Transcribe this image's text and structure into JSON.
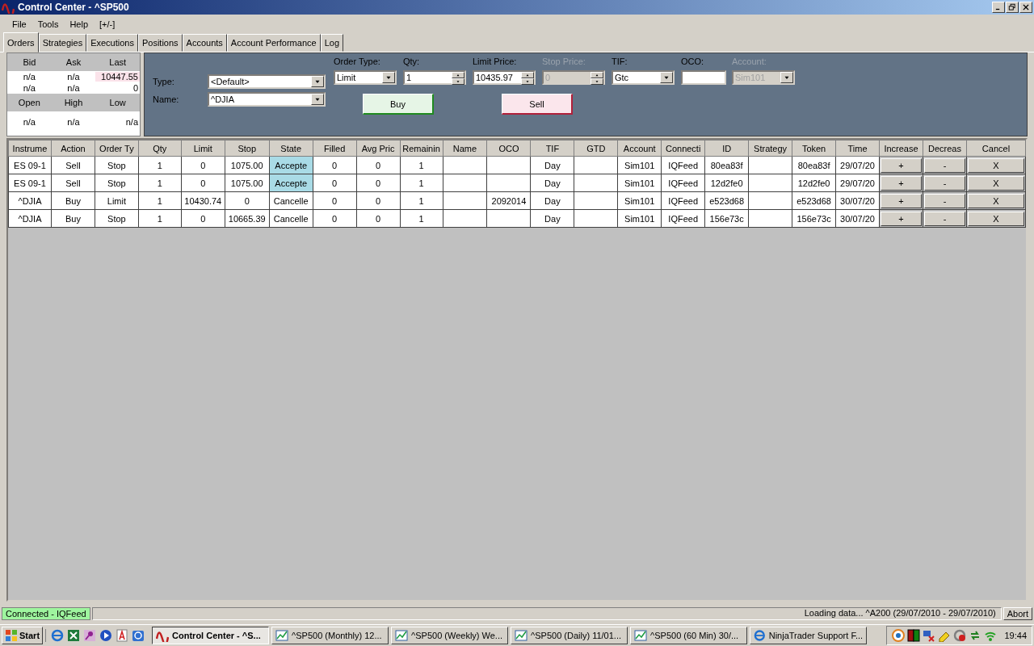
{
  "window": {
    "title": "Control Center - ^SP500"
  },
  "menu": [
    "File",
    "Tools",
    "Help",
    "[+/-]"
  ],
  "tabs": [
    {
      "label": "Orders",
      "selected": true
    },
    {
      "label": "Strategies",
      "selected": false
    },
    {
      "label": "Executions",
      "selected": false
    },
    {
      "label": "Positions",
      "selected": false
    },
    {
      "label": "Accounts",
      "selected": false
    },
    {
      "label": "Account Performance",
      "selected": false
    },
    {
      "label": "Log",
      "selected": false
    }
  ],
  "quote": {
    "headers": [
      "Bid",
      "Ask",
      "Last"
    ],
    "rows": [
      [
        "n/a",
        "n/a",
        "10447.55"
      ],
      [
        "n/a",
        "n/a",
        "0"
      ]
    ],
    "last_highlighted": true,
    "headers2": [
      "Open",
      "High",
      "Low"
    ],
    "rows2": [
      [
        "n/a",
        "n/a",
        "n/a"
      ]
    ]
  },
  "order_entry": {
    "type_label": "Type:",
    "type_value": "<Default>",
    "name_label": "Name:",
    "name_value": "^DJIA",
    "fields": [
      {
        "label": "Order Type:",
        "kind": "dropdown",
        "value": "Limit",
        "disabled": false
      },
      {
        "label": "Qty:",
        "kind": "spinner",
        "value": "1",
        "disabled": false
      },
      {
        "label": "Limit Price:",
        "kind": "spinner",
        "value": "10435.97",
        "disabled": false
      },
      {
        "label": "Stop Price:",
        "kind": "spinner",
        "value": "0",
        "disabled": true
      },
      {
        "label": "TIF:",
        "kind": "dropdown",
        "value": "Gtc",
        "disabled": false
      },
      {
        "label": "OCO:",
        "kind": "text",
        "disabled": false
      },
      {
        "label": "Account:",
        "kind": "dropdown",
        "value": "Sim101",
        "disabled": true
      }
    ],
    "buttons": [
      {
        "label": "Buy",
        "kind": "buy"
      },
      {
        "label": "Sell",
        "kind": "sell"
      }
    ]
  },
  "orders": {
    "columns": [
      "Instrume",
      "Action",
      "Order Ty",
      "Qty",
      "Limit",
      "Stop",
      "State",
      "Filled",
      "Avg Pric",
      "Remainin",
      "Name",
      "OCO",
      "TIF",
      "GTD",
      "Account",
      "Connecti",
      "ID",
      "Strategy",
      "Token",
      "Time",
      "Increase",
      "Decreas",
      "Cancel"
    ],
    "rows": [
      {
        "state_highlighted": true,
        "cells": [
          "ES 09-1",
          "Sell",
          "Stop",
          "1",
          "0",
          "1075.00",
          "Accepte",
          "0",
          "0",
          "1",
          "",
          "",
          "Day",
          "",
          "Sim101",
          "IQFeed",
          "80ea83f",
          "",
          "80ea83f",
          "29/07/20",
          "+",
          "-",
          "X"
        ]
      },
      {
        "state_highlighted": true,
        "cells": [
          "ES 09-1",
          "Sell",
          "Stop",
          "1",
          "0",
          "1075.00",
          "Accepte",
          "0",
          "0",
          "1",
          "",
          "",
          "Day",
          "",
          "Sim101",
          "IQFeed",
          "12d2fe0",
          "",
          "12d2fe0",
          "29/07/20",
          "+",
          "-",
          "X"
        ]
      },
      {
        "state_highlighted": false,
        "cells": [
          "^DJIA",
          "Buy",
          "Limit",
          "1",
          "10430.74",
          "0",
          "Cancelle",
          "0",
          "0",
          "1",
          "",
          "2092014",
          "Day",
          "",
          "Sim101",
          "IQFeed",
          "e523d68",
          "",
          "e523d68",
          "30/07/20",
          "+",
          "-",
          "X"
        ]
      },
      {
        "state_highlighted": false,
        "cells": [
          "^DJIA",
          "Buy",
          "Stop",
          "1",
          "0",
          "10665.39",
          "Cancelle",
          "0",
          "0",
          "1",
          "",
          "",
          "Day",
          "",
          "Sim101",
          "IQFeed",
          "156e73c",
          "",
          "156e73c",
          "30/07/20",
          "+",
          "-",
          "X"
        ]
      }
    ]
  },
  "status_bar": {
    "connection": "Connected - IQFeed",
    "message": "Loading data... ^A200  (29/07/2010 - 29/07/2010)",
    "abort": "Abort"
  },
  "taskbar": {
    "start": "Start",
    "tasks": [
      {
        "label": "Control Center - ^S...",
        "selected": true
      },
      {
        "label": "^SP500 (Monthly)  12...",
        "selected": false
      },
      {
        "label": "^SP500 (Weekly)  We...",
        "selected": false
      },
      {
        "label": "^SP500 (Daily)  11/01...",
        "selected": false
      },
      {
        "label": "^SP500 (60 Min)  30/...",
        "selected": false
      },
      {
        "label": "NinjaTrader Support F...",
        "selected": false
      }
    ],
    "clock": "19:44"
  }
}
